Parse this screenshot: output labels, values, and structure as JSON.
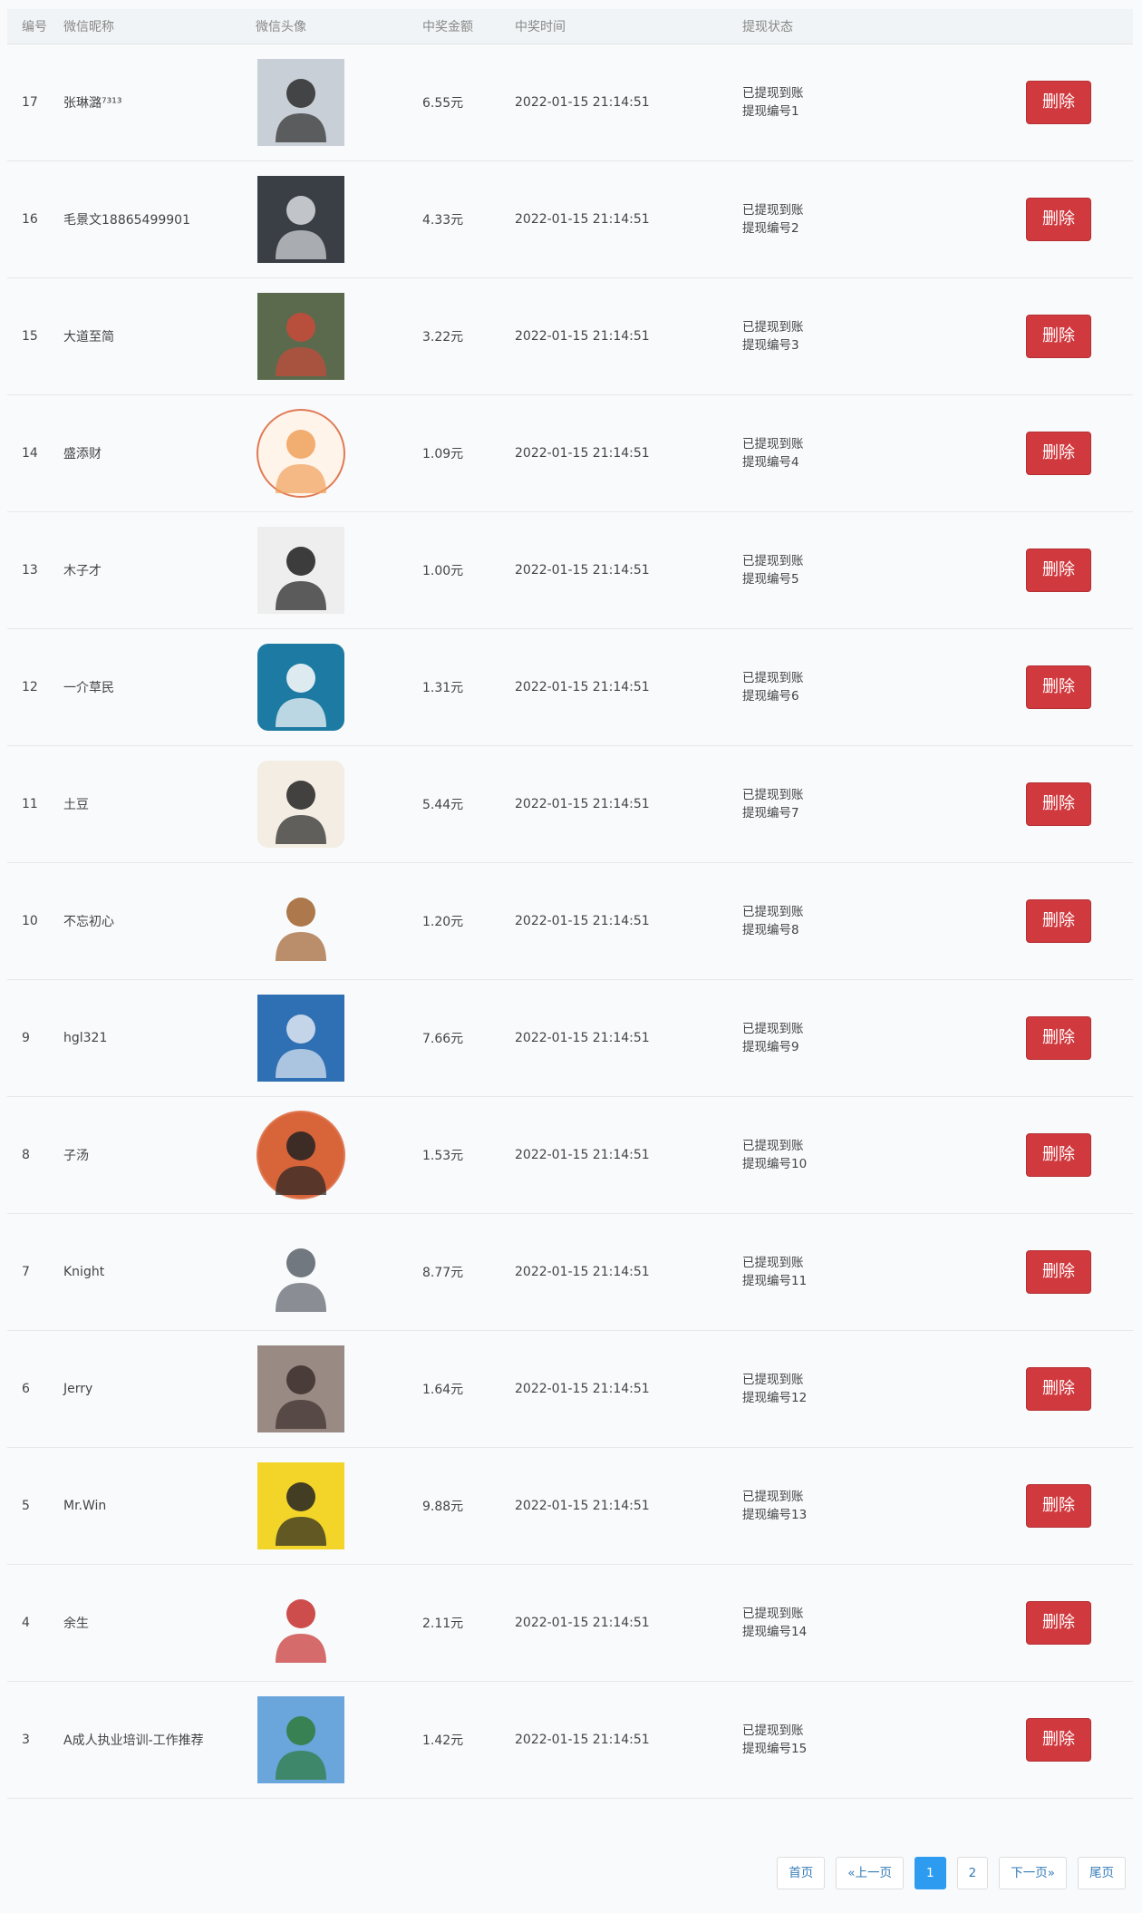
{
  "table": {
    "headers": {
      "id": "编号",
      "nickname": "微信昵称",
      "avatar": "微信头像",
      "amount": "中奖金额",
      "time": "中奖时间",
      "status": "提现状态"
    },
    "delete_label": "删除",
    "rows": [
      {
        "id": "17",
        "nickname": "张琳潞⁷³¹³",
        "amount": "6.55元",
        "time": "2022-01-15 21:14:51",
        "status": "已提现到账",
        "ref": "提现编号1",
        "avatar": {
          "shape": "square",
          "bg": "#c9cfd6",
          "fg": "#2b2b2b",
          "icon": "portrait-woman"
        }
      },
      {
        "id": "16",
        "nickname": "毛景文18865499901",
        "amount": "4.33元",
        "time": "2022-01-15 21:14:51",
        "status": "已提现到账",
        "ref": "提现编号2",
        "avatar": {
          "shape": "square",
          "bg": "#3a3f45",
          "fg": "#d9dde0",
          "icon": "parking-lot-photo"
        }
      },
      {
        "id": "15",
        "nickname": "大道至简",
        "amount": "3.22元",
        "time": "2022-01-15 21:14:51",
        "status": "已提现到账",
        "ref": "提现编号3",
        "avatar": {
          "shape": "square",
          "bg": "#5b6a4d",
          "fg": "#c94a3a",
          "icon": "flowers-photo"
        }
      },
      {
        "id": "14",
        "nickname": "盛添财",
        "amount": "1.09元",
        "time": "2022-01-15 21:14:51",
        "status": "已提现到账",
        "ref": "提现编号4",
        "avatar": {
          "shape": "circle",
          "bg": "#fff4ea",
          "fg": "#f0a05a",
          "icon": "cartoon-faces"
        }
      },
      {
        "id": "13",
        "nickname": "木子才",
        "amount": "1.00元",
        "time": "2022-01-15 21:14:51",
        "status": "已提现到账",
        "ref": "提现编号5",
        "avatar": {
          "shape": "square",
          "bg": "#eeeeee",
          "fg": "#1c1c1c",
          "icon": "portrait-man-suit"
        }
      },
      {
        "id": "12",
        "nickname": "一介草民",
        "amount": "1.31元",
        "time": "2022-01-15 21:14:51",
        "status": "已提现到账",
        "ref": "提现编号6",
        "avatar": {
          "shape": "rounded",
          "bg": "#1d7aa3",
          "fg": "#ffffff",
          "icon": "boat-with-flag"
        }
      },
      {
        "id": "11",
        "nickname": "土豆",
        "amount": "5.44元",
        "time": "2022-01-15 21:14:51",
        "status": "已提现到账",
        "ref": "提现编号7",
        "avatar": {
          "shape": "rounded",
          "bg": "#f3ede3",
          "fg": "#222222",
          "icon": "cartoon-girl-with-flag"
        }
      },
      {
        "id": "10",
        "nickname": "不忘初心",
        "amount": "1.20元",
        "time": "2022-01-15 21:14:51",
        "status": "已提现到账",
        "ref": "提现编号8",
        "avatar": {
          "shape": "none",
          "bg": "#ffffff",
          "fg": "#a0602c",
          "icon": "cartoon-boy"
        }
      },
      {
        "id": "9",
        "nickname": "hgl321",
        "amount": "7.66元",
        "time": "2022-01-15 21:14:51",
        "status": "已提现到账",
        "ref": "提现编号9",
        "avatar": {
          "shape": "square",
          "bg": "#2f6fb4",
          "fg": "#dfe8f2",
          "icon": "snow-landscape"
        }
      },
      {
        "id": "8",
        "nickname": "子汤",
        "amount": "1.53元",
        "time": "2022-01-15 21:14:51",
        "status": "已提现到账",
        "ref": "提现编号10",
        "avatar": {
          "shape": "circle",
          "bg": "#d8643a",
          "fg": "#222222",
          "icon": "portrait-man-glasses"
        }
      },
      {
        "id": "7",
        "nickname": "Knight",
        "amount": "8.77元",
        "time": "2022-01-15 21:14:51",
        "status": "已提现到账",
        "ref": "提现编号11",
        "avatar": {
          "shape": "none",
          "bg": "#ffffff",
          "fg": "#5b6068",
          "icon": "anime-character"
        }
      },
      {
        "id": "6",
        "nickname": "Jerry",
        "amount": "1.64元",
        "time": "2022-01-15 21:14:51",
        "status": "已提现到账",
        "ref": "提现编号12",
        "avatar": {
          "shape": "square",
          "bg": "#9a8a84",
          "fg": "#3b2e2b",
          "icon": "person-photo"
        }
      },
      {
        "id": "5",
        "nickname": "Mr.Win",
        "amount": "9.88元",
        "time": "2022-01-15 21:14:51",
        "status": "已提现到账",
        "ref": "提现编号13",
        "avatar": {
          "shape": "square",
          "bg": "#f3d52a",
          "fg": "#222222",
          "icon": "caricature-man"
        }
      },
      {
        "id": "4",
        "nickname": "余生",
        "amount": "2.11元",
        "time": "2022-01-15 21:14:51",
        "status": "已提现到账",
        "ref": "提现编号14",
        "avatar": {
          "shape": "none",
          "bg": "#ffffff",
          "fg": "#c62e2e",
          "icon": "bear-figure"
        }
      },
      {
        "id": "3",
        "nickname": "A成人执业培训-工作推荐",
        "amount": "1.42元",
        "time": "2022-01-15 21:14:51",
        "status": "已提现到账",
        "ref": "提现编号15",
        "avatar": {
          "shape": "square",
          "bg": "#6aa5dc",
          "fg": "#2e7a3a",
          "icon": "sea-landscape"
        }
      }
    ]
  },
  "pagination": {
    "first": "首页",
    "prev": "«上一页",
    "pages": [
      "1",
      "2"
    ],
    "active_page": "1",
    "next": "下一页»",
    "last": "尾页"
  }
}
